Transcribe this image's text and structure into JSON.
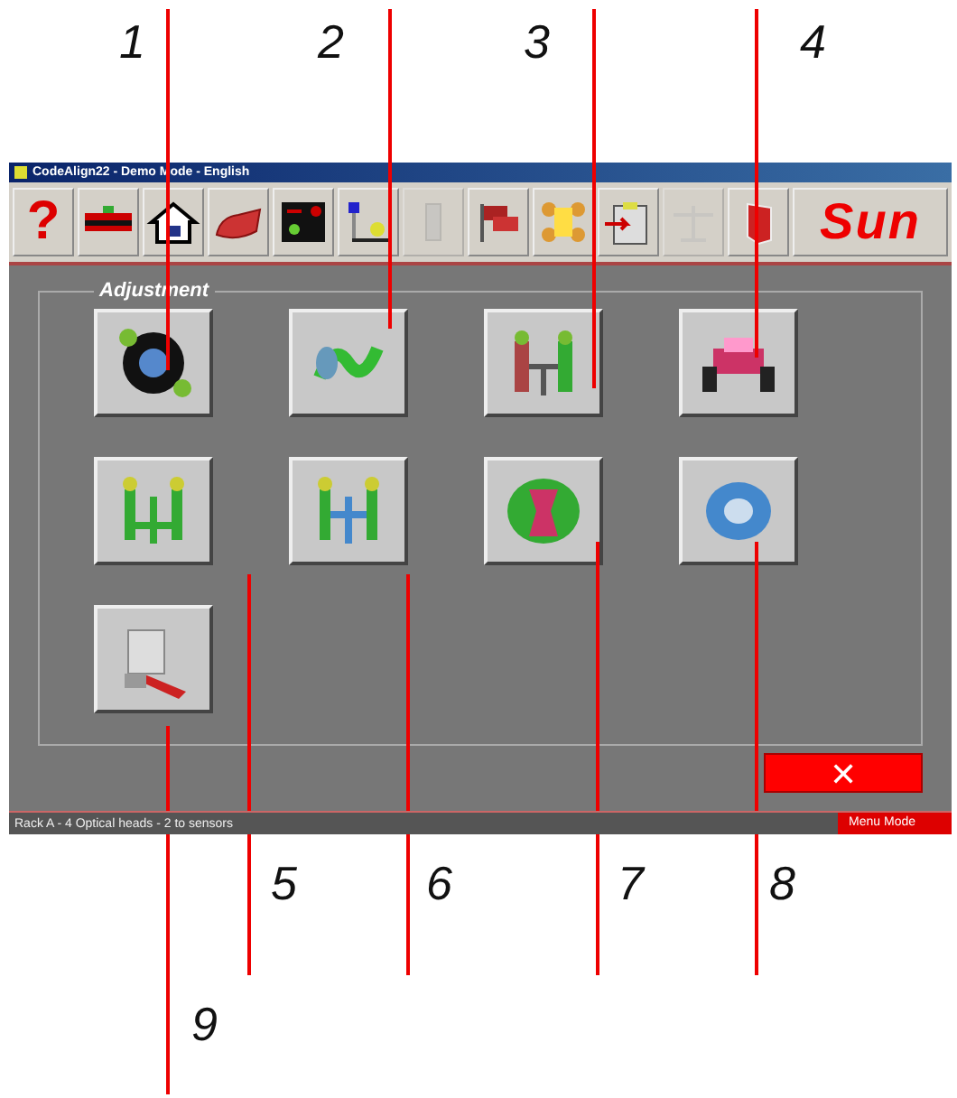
{
  "window": {
    "title": "CodeAlign22 - Demo Mode - English"
  },
  "toolbar": [
    {
      "kind": "help",
      "label": "?",
      "disabled": false
    },
    {
      "kind": "lift",
      "disabled": false
    },
    {
      "kind": "home",
      "disabled": false
    },
    {
      "kind": "car",
      "disabled": false
    },
    {
      "kind": "screen",
      "disabled": false
    },
    {
      "kind": "sensor",
      "disabled": false
    },
    {
      "kind": "column",
      "disabled": true
    },
    {
      "kind": "flags",
      "disabled": false
    },
    {
      "kind": "wheels",
      "disabled": false
    },
    {
      "kind": "clipboard",
      "disabled": false
    },
    {
      "kind": "scale",
      "disabled": true
    },
    {
      "kind": "door",
      "disabled": false
    },
    {
      "kind": "logo",
      "label": "Sun",
      "disabled": false
    }
  ],
  "adjustment": {
    "title": "Adjustment",
    "buttons": [
      {
        "kind": "wheel",
        "callout": "1"
      },
      {
        "kind": "spring",
        "callout": "2"
      },
      {
        "kind": "strut",
        "callout": "3"
      },
      {
        "kind": "car-front",
        "callout": "4"
      },
      {
        "kind": "axle",
        "callout": "5"
      },
      {
        "kind": "tie-rod",
        "callout": "6"
      },
      {
        "kind": "frame",
        "callout": "7"
      },
      {
        "kind": "bushing",
        "callout": "8"
      },
      {
        "kind": "tool",
        "callout": "9"
      }
    ]
  },
  "close_button": {
    "label": "✕"
  },
  "status_bar": {
    "text": "Rack A - 4 Optical heads - 2 to sensors",
    "mode": "Menu Mode"
  }
}
